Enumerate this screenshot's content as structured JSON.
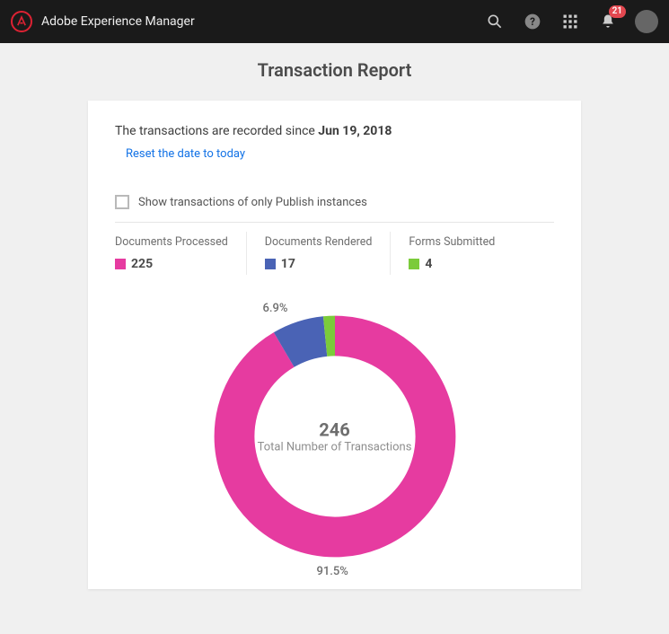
{
  "header": {
    "title": "Adobe Experience Manager",
    "notification_count": "21"
  },
  "page": {
    "title": "Transaction Report",
    "recorded_prefix": "The transactions are recorded since ",
    "recorded_date": "Jun 19, 2018",
    "reset_link": "Reset the date to today",
    "checkbox_label": "Show transactions of only Publish instances"
  },
  "stats": [
    {
      "label": "Documents Processed",
      "value": "225",
      "color": "#e63ba0"
    },
    {
      "label": "Documents Rendered",
      "value": "17",
      "color": "#4a63b5"
    },
    {
      "label": "Forms Submitted",
      "value": "4",
      "color": "#7bcb3a"
    }
  ],
  "chart": {
    "total": "246",
    "total_label": "Total Number of Transactions",
    "labels": {
      "big": "91.5%",
      "mid": "6.9%"
    }
  },
  "chart_data": {
    "type": "pie",
    "title": "Transaction Report",
    "categories": [
      "Documents Processed",
      "Documents Rendered",
      "Forms Submitted"
    ],
    "values": [
      225,
      17,
      4
    ],
    "percentages": [
      91.5,
      6.9,
      1.6
    ],
    "total": 246,
    "colors": [
      "#e63ba0",
      "#4a63b5",
      "#7bcb3a"
    ],
    "center_label": "Total Number of Transactions"
  }
}
